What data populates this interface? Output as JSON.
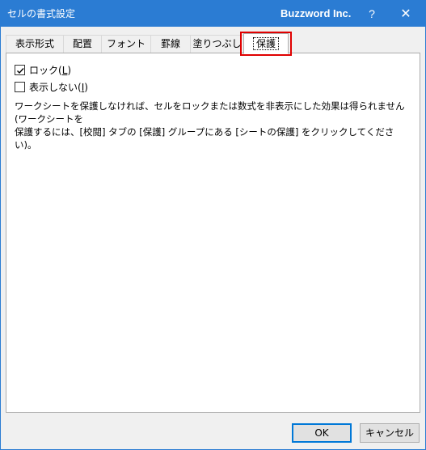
{
  "window": {
    "title": "セルの書式設定",
    "brand": "Buzzword Inc.",
    "help_symbol": "?",
    "close_symbol": "✕"
  },
  "tabs": [
    {
      "label": "表示形式",
      "active": false
    },
    {
      "label": "配置",
      "active": false
    },
    {
      "label": "フォント",
      "active": false
    },
    {
      "label": "罫線",
      "active": false
    },
    {
      "label": "塗りつぶし",
      "active": false
    },
    {
      "label": "保護",
      "active": true
    }
  ],
  "protection": {
    "lock": {
      "label_prefix": "ロック(",
      "accel": "L",
      "label_suffix": ")",
      "checked": true
    },
    "hidden": {
      "label_prefix": "表示しない(",
      "accel": "I",
      "label_suffix": ")",
      "checked": false
    },
    "description": "ワークシートを保護しなければ、セルをロックまたは数式を非表示にした効果は得られません (ワークシートを\n保護するには、[校閲] タブの [保護] グループにある [シートの保護] をクリックしてください)。"
  },
  "buttons": {
    "ok": "OK",
    "cancel": "キャンセル"
  },
  "colors": {
    "titlebar": "#2b7cd3",
    "highlight": "#e00000",
    "default_button_border": "#0078d7"
  }
}
